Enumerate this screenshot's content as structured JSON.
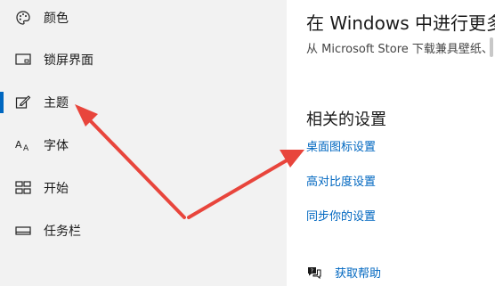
{
  "sidebar": {
    "items": [
      {
        "label": "颜色",
        "icon": "palette-icon"
      },
      {
        "label": "锁屏界面",
        "icon": "lock-screen-icon"
      },
      {
        "label": "主题",
        "icon": "theme-brush-icon",
        "selected": true
      },
      {
        "label": "字体",
        "icon": "font-icon"
      },
      {
        "label": "开始",
        "icon": "start-tiles-icon"
      },
      {
        "label": "任务栏",
        "icon": "taskbar-icon"
      }
    ]
  },
  "main": {
    "heading": "在 Windows 中进行更多",
    "description": "从 Microsoft Store 下载兼具壁纸、",
    "related": {
      "title": "相关的设置",
      "links": [
        "桌面图标设置",
        "高对比度设置",
        "同步你的设置"
      ]
    },
    "help": {
      "label": "获取帮助",
      "icon": "help-chat-icon"
    }
  },
  "colors": {
    "accent": "#0067c0",
    "annotation": "#e8453c",
    "sidebar_bg": "#f2f2f2"
  }
}
